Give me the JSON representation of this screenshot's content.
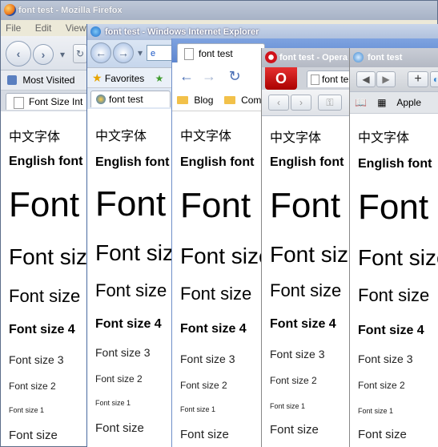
{
  "common": {
    "zh_text": "中文字体",
    "english": "English font",
    "font": "Font",
    "font_size": "Font size",
    "size4": "Font size 4",
    "size3": "Font size 3",
    "size2": "Font size 2",
    "size1": "Font size 1"
  },
  "firefox": {
    "title": "font test - Mozilla Firefox",
    "menu": [
      "File",
      "Edit",
      "View"
    ],
    "bookmark": "Most Visited",
    "tab": "Font Size Int"
  },
  "ie": {
    "title": "font test - Windows Internet Explorer",
    "address_prefix": "e",
    "favorites": "Favorites",
    "tab": "font test"
  },
  "chrome": {
    "tab": "font test",
    "bookmarks": [
      "Blog",
      "Comm"
    ]
  },
  "opera": {
    "title": "font test - Opera",
    "tab": "font te"
  },
  "safari": {
    "title": "font test",
    "bookmark": "Apple"
  }
}
